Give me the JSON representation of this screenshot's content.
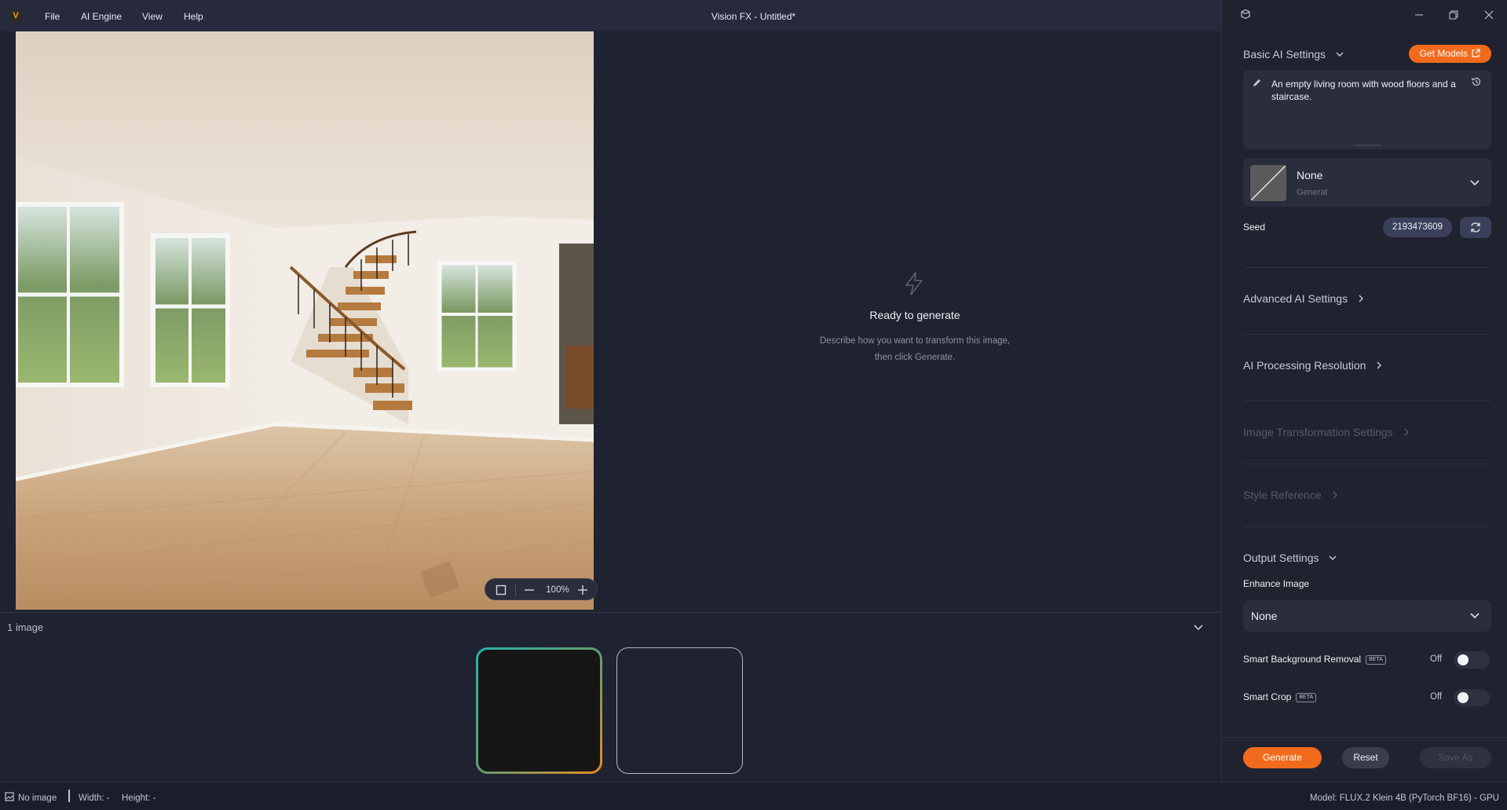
{
  "app": {
    "logo": "V",
    "title": "Vision FX - Untitled*"
  },
  "menu": {
    "file": "File",
    "ai_engine": "AI Engine",
    "view": "View",
    "help": "Help"
  },
  "canvas": {
    "zoom": "100%"
  },
  "empty_state": {
    "icon": "lightning-icon",
    "title": "Ready to generate",
    "description": "Describe how you want to transform this image, then click Generate."
  },
  "strip": {
    "count": "1 image"
  },
  "panel": {
    "basic_title": "Basic AI Settings",
    "get_models": "Get Models",
    "prompt": "An empty living room with wood floors and a staircase.",
    "style": {
      "name": "None",
      "category": "General"
    },
    "seed_label": "Seed",
    "seed_value": "2193473609",
    "advanced_title": "Advanced AI Settings",
    "resolution_title": "AI Processing Resolution",
    "transform_title": "Image Transformation Settings",
    "style_ref_title": "Style Reference",
    "output_title": "Output Settings",
    "enhance_label": "Enhance Image",
    "enhance_value": "None",
    "bg_removal_label": "Smart Background Removal",
    "bg_removal_state": "Off",
    "crop_label": "Smart Crop",
    "crop_state": "Off",
    "beta": "BETA",
    "generate": "Generate",
    "reset": "Reset",
    "save_as": "Save As"
  },
  "status": {
    "image": "No image",
    "width": "Width: -",
    "height": "Height: -",
    "model": "Model: FLUX.2 Klein 4B (PyTorch BF16) - GPU"
  },
  "colors": {
    "accent": "#f26b1c",
    "background": "#1f2230",
    "panel": "#20232f"
  }
}
